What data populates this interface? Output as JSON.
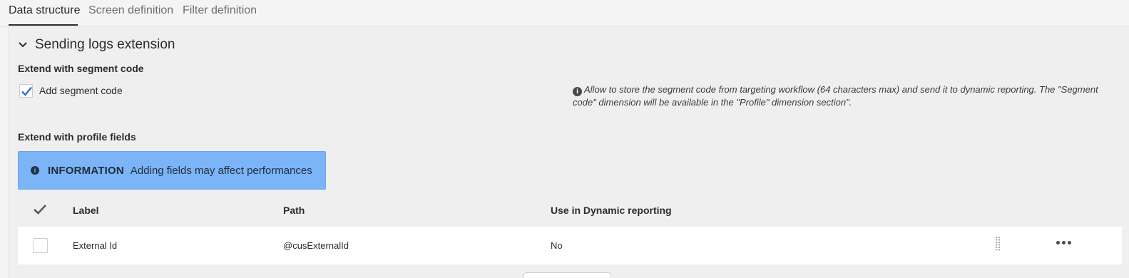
{
  "tabs": [
    {
      "label": "Data structure",
      "active": true
    },
    {
      "label": "Screen definition",
      "active": false
    },
    {
      "label": "Filter definition",
      "active": false
    }
  ],
  "section": {
    "title": "Sending logs extension",
    "segment": {
      "heading": "Extend with segment code",
      "checkbox_label": "Add segment code",
      "checked": true,
      "hint": "Allow to store the segment code from targeting workflow (64 characters max) and send it to dynamic reporting. The \"Segment code\" dimension will be available in the \"Profile\" dimension section\"."
    },
    "profile": {
      "heading": "Extend with profile fields",
      "info_title": "INFORMATION",
      "info_message": "Adding fields may affect performances"
    }
  },
  "table": {
    "columns": [
      "Label",
      "Path",
      "Use in Dynamic reporting"
    ],
    "rows": [
      {
        "label": "External Id",
        "path": "@cusExternalId",
        "dynamic_reporting": "No"
      }
    ]
  },
  "colors": {
    "accent": "#2b6fd6",
    "info_background": "#7cb4f8"
  }
}
